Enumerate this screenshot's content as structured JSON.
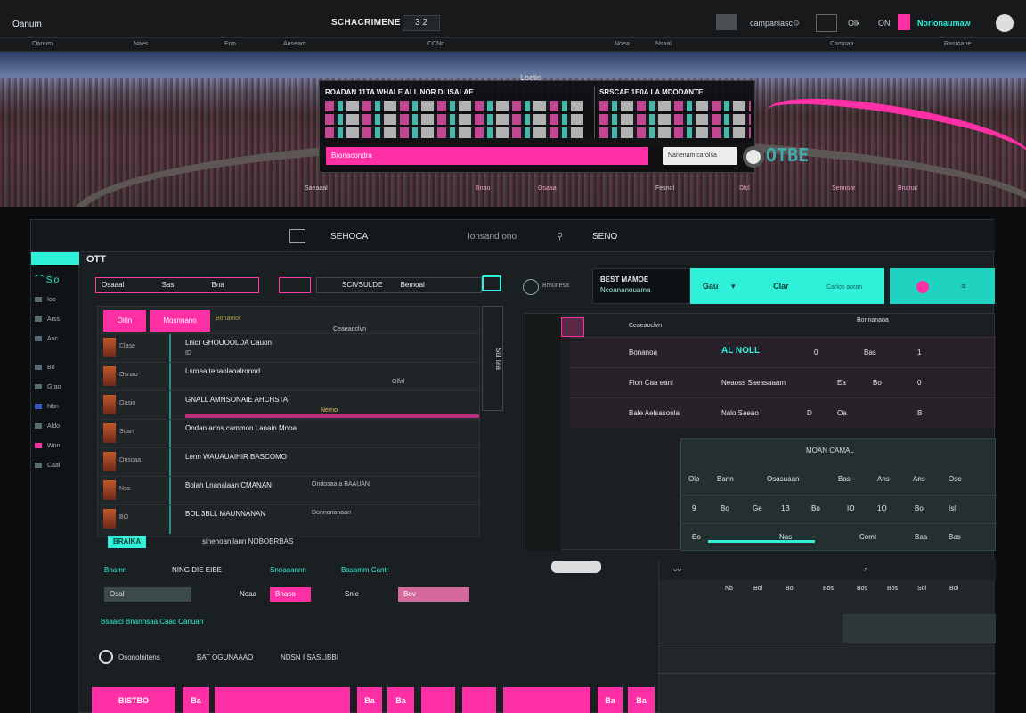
{
  "colors": {
    "accent_pink": "#ff2fa6",
    "accent_teal": "#2ff0d8",
    "bg": "#0b0d0f",
    "panel": "#1a1f22"
  },
  "topbar": {
    "brand": "Oanum",
    "center_title": "SCHACRIMENE",
    "center_badge": "3 2",
    "right_items": [
      "campaniasc",
      "Olk",
      "ON",
      "Norlonaumaw"
    ],
    "nav": [
      "Oanum",
      "Naes",
      "Erm",
      "Auseam",
      "CCNn",
      "Noea",
      "Nsaal",
      "Camnaa",
      "Rasroane"
    ]
  },
  "hero": {
    "heading": "Loelio",
    "col1_title": "ROADAN 11TA WHALE ALL NOR DLISALAE",
    "col2_title": "SRSCAE 1E0A LA MDODANTE",
    "bar_label": "Bronacondra",
    "input_placeholder": "Nanenam carolsa",
    "logo": "OTBE",
    "footer": [
      "Saeaaal",
      "Bnao",
      "Osaaa",
      "Fesnol",
      "Dlcl",
      "Sennoar",
      "Bnanal"
    ]
  },
  "main": {
    "tabs": [
      "SEHOCA",
      "Ionsand ono",
      "SENO"
    ],
    "section_title": "OTT",
    "sidebar_logo": "⌒ Sio",
    "sidebar_items": [
      "Ioo",
      "Arss",
      "Aoc",
      "Bo",
      "Grao",
      "Nbn",
      "Aldo",
      "Wnn",
      "Caal"
    ],
    "controls": {
      "a": "Osaaal",
      "b": "Sas",
      "c": "Bna",
      "d": "SCIVSULDE",
      "e": "Bemoal"
    },
    "right_header": {
      "dark1_a": "BEST MAMOE",
      "dark1_b": "Ncoananouama",
      "teal_a": "Gau",
      "teal_b": "Clar",
      "extra": "Carlos aoran",
      "info": "Brnunesa"
    },
    "list_tabs": [
      "Oitin",
      "Mosnnano"
    ],
    "list_tag": "Bonamor",
    "list_rows": [
      {
        "tag": "Clase",
        "title": "Lnicr GHOUOOLDA Cauon",
        "sub": "ID"
      },
      {
        "tag": "Osnao",
        "title": "Lsrnea tenaolaoalronnd",
        "sub": "Olfal"
      },
      {
        "tag": "Oasio",
        "title": "GNALL AMNSONAIE AHCHSTA",
        "sub": "Nerno"
      },
      {
        "tag": "Scan",
        "title": "Ondan anns cammon Lanain Mnoa",
        "sub": ""
      },
      {
        "tag": "Onscaa",
        "title": "Lenn WAUAUAIHIR BASCOMO",
        "sub": ""
      },
      {
        "tag": "Nss",
        "title": "Bolah Lnanalaan CMANAN",
        "sub": "Ondosaa a BAAUAN"
      },
      {
        "tag": "BO",
        "title": "BOL 3BLL MAUNNANAN",
        "sub": "Donnonanaan"
      }
    ],
    "list_footer_btn": "BRAIKA",
    "list_footer_text": "sinenoanilann NOBOBRBAS",
    "scroll_label": "Sul Iaa",
    "rtable": {
      "head": [
        "Ceaeaoclvn",
        "Bonnanaoa"
      ],
      "rows": [
        {
          "a": "Bonanoa",
          "b": "AL NOLL",
          "c": "0",
          "d": "Bas",
          "e": "1"
        },
        {
          "a": "Flon Caa eanl",
          "b": "Neaoss Saeasaaam",
          "c": "Ea",
          "d": "Bo",
          "e": "0"
        },
        {
          "a": "Bale Aelsasonla",
          "b": "Nalo Saeao",
          "c": "D",
          "d": "Oa",
          "e": "B"
        }
      ],
      "grid_title": "MOAN CAMAL",
      "grid_head": [
        "Olo",
        "Bann",
        "Osasuaan",
        "Bas",
        "Ans",
        "Ans",
        "Ose"
      ],
      "grid_rows": [
        [
          "9",
          "Bo",
          "Ge",
          "1B",
          "Bo",
          "IO",
          "1O",
          "Bo",
          "Isl"
        ],
        [
          "Eo",
          "",
          "Nas",
          "",
          "",
          "Comt",
          "",
          "Baa",
          "Bas"
        ]
      ]
    },
    "bottom": {
      "row1": [
        "Bnamn",
        "NING DIE EIBE",
        "Snoaoannn",
        "Basamm Cantr"
      ],
      "row2": [
        "Osal",
        "Bnaso",
        "Noaa",
        "Snie",
        "Bov"
      ],
      "row3": "Bsaaicl Bnannsaa Caac Canuan",
      "row4": [
        "Osonolnitens",
        "BAT OGUNAAAO",
        "NDSN I SASLIBBI"
      ],
      "grid_cols": [
        "Nb",
        "Bol",
        "Bo",
        "Bos",
        "Bos",
        "Bos",
        "Sol",
        "Bol"
      ]
    },
    "pink_buttons": [
      "BISTBO",
      "Ba",
      "Ba",
      "Ba",
      "Ba",
      "Ba"
    ]
  }
}
